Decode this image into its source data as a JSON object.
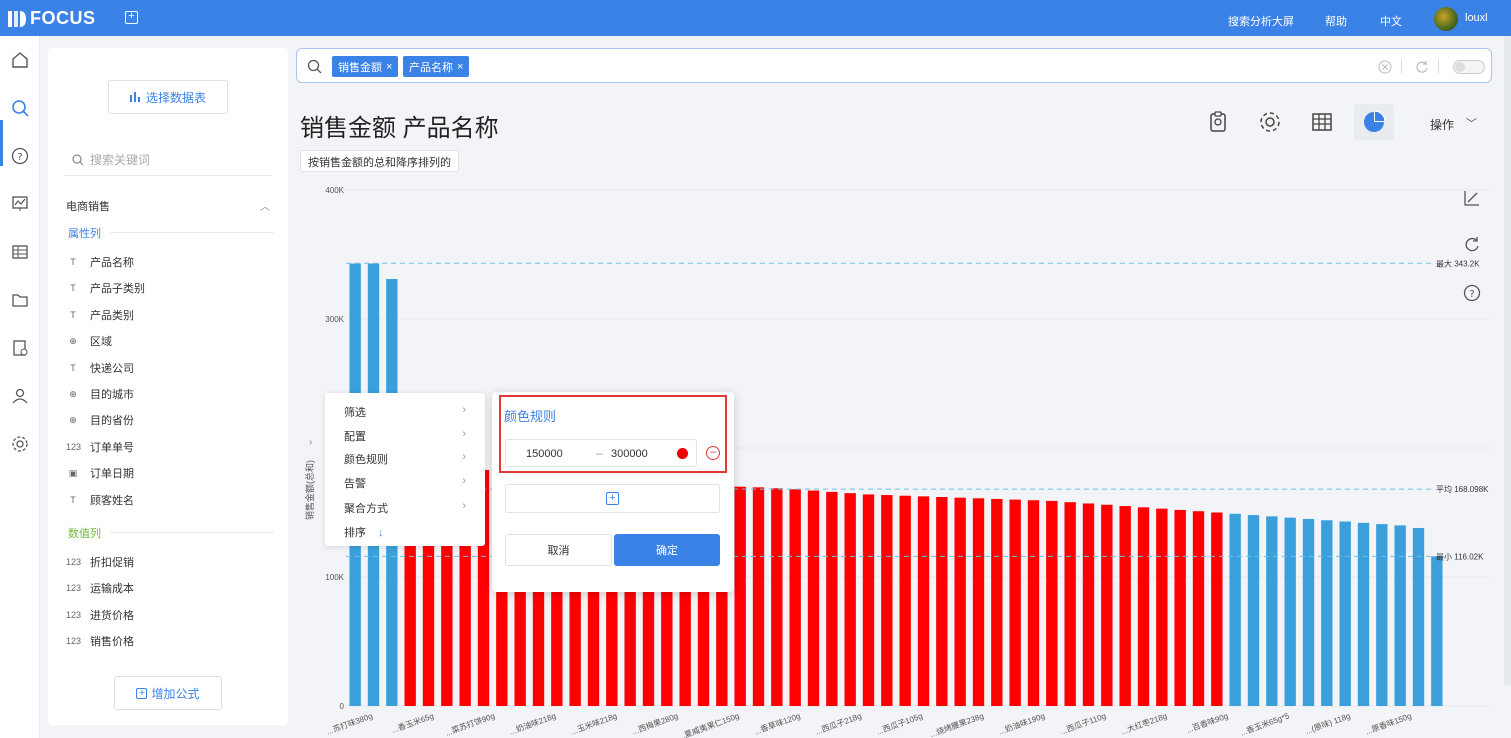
{
  "app": {
    "logo": "FOCUS"
  },
  "header": {
    "links": {
      "screen": "搜索分析大屏",
      "help": "帮助",
      "lang": "中文"
    },
    "user": "louxl"
  },
  "sidebar": {
    "select_table": "选择数据表",
    "search_placeholder": "搜索关键词",
    "group": "电商销售",
    "attr_section": "属性列",
    "attr_fields": [
      {
        "icon": "text-icon",
        "label": "产品名称"
      },
      {
        "icon": "text-icon",
        "label": "产品子类别"
      },
      {
        "icon": "text-icon",
        "label": "产品类别"
      },
      {
        "icon": "globe-icon",
        "label": "区域"
      },
      {
        "icon": "text-icon",
        "label": "快递公司"
      },
      {
        "icon": "globe-icon",
        "label": "目的城市"
      },
      {
        "icon": "globe-icon",
        "label": "目的省份"
      },
      {
        "icon": "number-icon",
        "label": "订单单号"
      },
      {
        "icon": "calendar-icon",
        "label": "订单日期"
      },
      {
        "icon": "text-icon",
        "label": "顾客姓名"
      }
    ],
    "num_section": "数值列",
    "num_fields": [
      {
        "icon": "number-icon",
        "label": "折扣促销"
      },
      {
        "icon": "number-icon",
        "label": "运输成本"
      },
      {
        "icon": "number-icon",
        "label": "进货价格"
      },
      {
        "icon": "number-icon",
        "label": "销售价格"
      }
    ],
    "add_formula": "增加公式"
  },
  "search": {
    "chips": [
      "销售金额",
      "产品名称"
    ]
  },
  "main": {
    "title": "销售金额 产品名称",
    "subtitle": "按销售金额的总和降序排列的",
    "op_label": "操作"
  },
  "context_menu": {
    "items": [
      "筛选",
      "配置",
      "颜色规则",
      "告警",
      "聚合方式",
      "排序"
    ]
  },
  "color_rule_dialog": {
    "title": "颜色规则",
    "min": "150000",
    "max": "300000",
    "dash": "–",
    "rule_color": "#ee0000",
    "cancel": "取消",
    "confirm": "确定"
  },
  "chart_data": {
    "type": "bar",
    "ylabel": "销售金额(总和)",
    "yticks": [
      "0",
      "100K",
      "300K",
      "400K"
    ],
    "ylim": [
      0,
      400000
    ],
    "ref_lines": [
      {
        "label": "最大 343.2K",
        "value": 343200
      },
      {
        "label": "平均 168.098K",
        "value": 168098
      },
      {
        "label": "最小 116.02K",
        "value": 116020
      }
    ],
    "default_color": "#3a9fdb",
    "highlight_color": "#ff0000",
    "highlight_range": [
      150000,
      300000
    ],
    "xticks": [
      "...苏打味380g",
      "...香玉米65g",
      "...菜苏打饼90g",
      "...奶油味218g",
      "...玉米味218g",
      "...西梅果280g",
      "...夏威夷果仁150g",
      "...香草味120g",
      "...西瓜子218g",
      "...西瓜子105g",
      "...烧烤腰果238g",
      "...奶油味190g",
      "...西瓜子110g",
      "...大红枣218g",
      "...百香味90g",
      "...香玉米65g*5",
      "...(原味) 118g",
      "...原香味150g"
    ],
    "values": [
      343000,
      343000,
      331000,
      208000,
      192000,
      192000,
      184000,
      183000,
      182000,
      181000,
      180000,
      179000,
      178500,
      178000,
      177000,
      176000,
      175000,
      174000,
      173000,
      172000,
      171000,
      170000,
      169500,
      168800,
      168000,
      167000,
      166000,
      165000,
      164000,
      163500,
      163000,
      162500,
      162000,
      161500,
      161000,
      160500,
      160000,
      159500,
      159000,
      158000,
      157000,
      156000,
      155000,
      154000,
      153000,
      152000,
      151000,
      150000,
      149000,
      148000,
      147000,
      146000,
      145000,
      144000,
      143000,
      142000,
      141000,
      140000,
      138000,
      116020
    ]
  }
}
